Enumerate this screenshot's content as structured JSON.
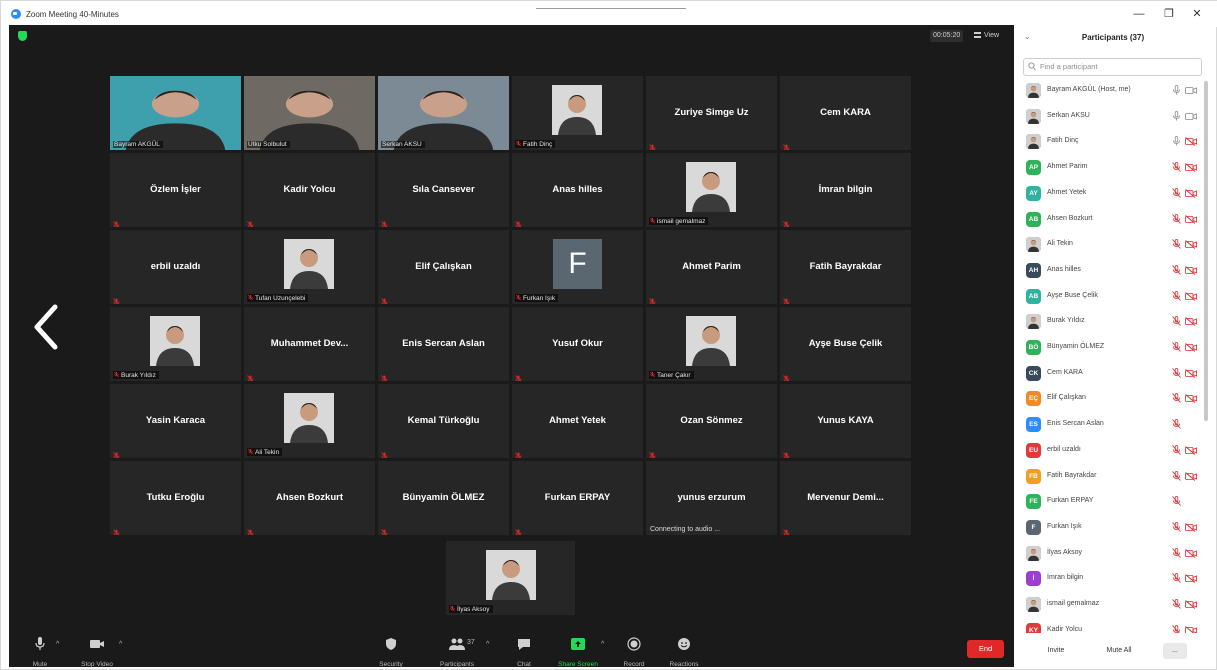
{
  "window": {
    "title": "Zoom Meeting 40-Minutes",
    "minimize": "—",
    "maximize": "❐",
    "close": "✕"
  },
  "meeting": {
    "timer": "00:05:20",
    "view_label": "View",
    "tiles": [
      {
        "name": "Bayram AKGÜL",
        "type": "video",
        "label": "Bayram AKGÜL",
        "active": true,
        "bg": "#3fa0ad"
      },
      {
        "name": "Utku Solbulut",
        "type": "video",
        "label": "Utku Solbulut",
        "bg": "#6e6a63"
      },
      {
        "name": "Serkan AKSU",
        "type": "video",
        "label": "Serkan AKSU",
        "bg": "#7b8a95"
      },
      {
        "name": "Fatih Dinç",
        "type": "photo",
        "label": "Fatih Dinç"
      },
      {
        "name": "Zuriye Simge Uz",
        "type": "name"
      },
      {
        "name": "Cem KARA",
        "type": "name"
      },
      {
        "name": "Özlem İşler",
        "type": "name"
      },
      {
        "name": "Kadir Yolcu",
        "type": "name"
      },
      {
        "name": "Sıla Cansever",
        "type": "name"
      },
      {
        "name": "Anas hilles",
        "type": "name"
      },
      {
        "name": "ismail gemalmaz",
        "type": "photo",
        "label": "ismail gemalmaz"
      },
      {
        "name": "İmran bilgin",
        "type": "name"
      },
      {
        "name": "erbil uzaldı",
        "type": "name"
      },
      {
        "name": "Tufan Uzunçelebi",
        "type": "photo",
        "label": "Tufan Uzunçelebi"
      },
      {
        "name": "Elif Çalışkan",
        "type": "name"
      },
      {
        "name": "Furkan Işık",
        "type": "initial",
        "initial": "F",
        "label": "Furkan Işık"
      },
      {
        "name": "Ahmet Parim",
        "type": "name"
      },
      {
        "name": "Fatih Bayrakdar",
        "type": "name"
      },
      {
        "name": "Burak Yıldız",
        "type": "photo",
        "label": "Burak Yıldız"
      },
      {
        "name": "Muhammet Dev...",
        "type": "name"
      },
      {
        "name": "Enis Sercan Aslan",
        "type": "name"
      },
      {
        "name": "Yusuf Okur",
        "type": "name"
      },
      {
        "name": "Taner Çakır",
        "type": "photo",
        "label": "Taner Çakır"
      },
      {
        "name": "Ayşe Buse Çelik",
        "type": "name"
      },
      {
        "name": "Yasin Karaca",
        "type": "name"
      },
      {
        "name": "Ali Tekin",
        "type": "photo",
        "label": "Ali Tekin"
      },
      {
        "name": "Kemal Türkoğlu",
        "type": "name"
      },
      {
        "name": "Ahmet Yetek",
        "type": "name"
      },
      {
        "name": "Ozan Sönmez",
        "type": "name"
      },
      {
        "name": "Yunus KAYA",
        "type": "name"
      },
      {
        "name": "Tutku Eroğlu",
        "type": "name"
      },
      {
        "name": "Ahsen Bozkurt",
        "type": "name"
      },
      {
        "name": "Bünyamin ÖLMEZ",
        "type": "name"
      },
      {
        "name": "Furkan ERPAY",
        "type": "name"
      },
      {
        "name": "yunus erzurum",
        "type": "name",
        "status": "Connecting to audio ..."
      },
      {
        "name": "Mervenur Demi...",
        "type": "name"
      },
      {
        "name": "İlyas Aksoy",
        "type": "photo",
        "label": "İlyas Aksoy"
      }
    ]
  },
  "toolbar": {
    "mute": "Mute",
    "stop_video": "Stop Video",
    "security": "Security",
    "participants": "Participants",
    "participants_count": "37",
    "chat": "Chat",
    "share_screen": "Share Screen",
    "record": "Record",
    "reactions": "Reactions",
    "end": "End"
  },
  "panel": {
    "title": "Participants (37)",
    "search_placeholder": "Find a participant",
    "participants": [
      {
        "name": "Bayram AKGÜL (Host, me)",
        "avatar": "photo",
        "mic": "on",
        "cam": "on"
      },
      {
        "name": "Serkan AKSU",
        "avatar": "photo",
        "mic": "on",
        "cam": "on"
      },
      {
        "name": "Fatih Dinç",
        "avatar": "photo",
        "mic": "on",
        "cam": "off"
      },
      {
        "name": "Ahmet Parim",
        "avatar": "AP",
        "color": "#2fb35a",
        "mic": "off",
        "cam": "off"
      },
      {
        "name": "Ahmet Yetek",
        "avatar": "AY",
        "color": "#2fb3a0",
        "mic": "off",
        "cam": "off"
      },
      {
        "name": "Ahsen Bozkurt",
        "avatar": "AB",
        "color": "#2fb35a",
        "mic": "off",
        "cam": "off"
      },
      {
        "name": "Ali Tekin",
        "avatar": "photo",
        "mic": "off",
        "cam": "off"
      },
      {
        "name": "Anas hilles",
        "avatar": "AH",
        "color": "#3a4a5a",
        "mic": "off",
        "cam": "off"
      },
      {
        "name": "Ayşe Buse Çelik",
        "avatar": "AB",
        "color": "#2fb3a0",
        "mic": "off",
        "cam": "off"
      },
      {
        "name": "Burak Yıldız",
        "avatar": "photo",
        "mic": "off",
        "cam": "off"
      },
      {
        "name": "Bünyamin ÖLMEZ",
        "avatar": "BÖ",
        "color": "#2fb35a",
        "mic": "off",
        "cam": "off"
      },
      {
        "name": "Cem KARA",
        "avatar": "CK",
        "color": "#3a4a5a",
        "mic": "off",
        "cam": "off"
      },
      {
        "name": "Elif Çalışkan",
        "avatar": "EÇ",
        "color": "#f08a24",
        "mic": "off",
        "cam": "off"
      },
      {
        "name": "Enis Sercan Aslan",
        "avatar": "ES",
        "color": "#2d8cff",
        "mic": "off",
        "cam": "none"
      },
      {
        "name": "erbil uzaldı",
        "avatar": "EU",
        "color": "#e03a3a",
        "mic": "off",
        "cam": "off"
      },
      {
        "name": "Fatih Bayrakdar",
        "avatar": "FB",
        "color": "#f0a020",
        "mic": "off",
        "cam": "off"
      },
      {
        "name": "Furkan ERPAY",
        "avatar": "FE",
        "color": "#2fb35a",
        "mic": "off",
        "cam": "none"
      },
      {
        "name": "Furkan Işık",
        "avatar": "F",
        "color": "#5a6770",
        "mic": "off",
        "cam": "off"
      },
      {
        "name": "İlyas Aksoy",
        "avatar": "photo",
        "mic": "off",
        "cam": "off"
      },
      {
        "name": "İmran bilgin",
        "avatar": "İ",
        "color": "#9b3fd0",
        "mic": "off",
        "cam": "off"
      },
      {
        "name": "ismail gemalmaz",
        "avatar": "photo",
        "mic": "off",
        "cam": "off"
      },
      {
        "name": "Kadir Yolcu",
        "avatar": "KY",
        "color": "#e03a3a",
        "mic": "off",
        "cam": "off"
      }
    ],
    "invite": "Invite",
    "mute_all": "Mute All",
    "more": "..."
  }
}
